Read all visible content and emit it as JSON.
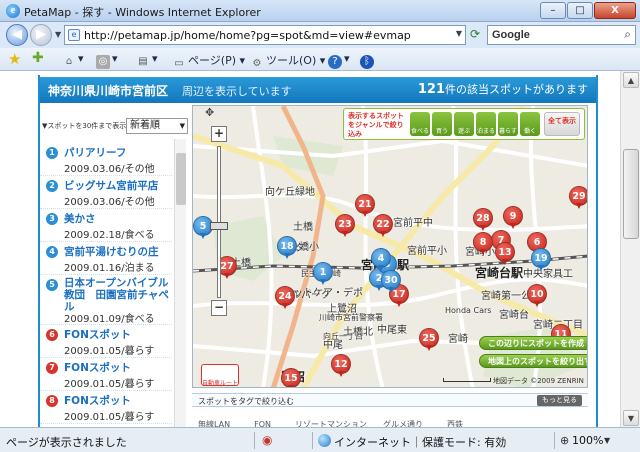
{
  "window": {
    "title": "PetaMap - 探す - Windows Internet Explorer",
    "logo_letter": "e",
    "minimize": "–",
    "maximize": "□",
    "close": "X"
  },
  "address": {
    "url": "http://petamap.jp/home/home?pg=spot&md=view#evmap",
    "search_placeholder": "Google"
  },
  "toolbar": {
    "page_menu": "ページ(P)",
    "tools_menu": "ツール(O)",
    "help_menu": "?"
  },
  "header": {
    "location": "神奈川県川崎市宮前区",
    "location_suffix": "周辺を表示しています",
    "count_number": "121",
    "count_text": "件の該当スポットがあります"
  },
  "sidebar": {
    "show_label": "▼スポットを30件まで表示",
    "sort_value": "新着順",
    "spots": [
      {
        "num": "1",
        "color": "blue",
        "name": "パリアリーフ",
        "meta": "2009.03.06/その他"
      },
      {
        "num": "2",
        "color": "blue",
        "name": "ビッグサム宮前平店",
        "meta": "2009.03.06/その他"
      },
      {
        "num": "3",
        "color": "blue",
        "name": "美かさ",
        "meta": "2009.02.18/食べる"
      },
      {
        "num": "4",
        "color": "blue",
        "name": "宮前平湯けむりの庄",
        "meta": "2009.01.16/泊まる"
      },
      {
        "num": "5",
        "color": "blue",
        "name": "日本オープンバイブル教団　田園宮前チャペル",
        "meta": "2009.01.09/食べる"
      },
      {
        "num": "6",
        "color": "red",
        "name": "FONスポット",
        "meta": "2009.01.05/暮らす"
      },
      {
        "num": "7",
        "color": "red",
        "name": "FONスポット",
        "meta": "2009.01.05/暮らす"
      },
      {
        "num": "8",
        "color": "red",
        "name": "FONスポット",
        "meta": "2009.01.05/暮らす"
      }
    ]
  },
  "map": {
    "genre_label": "表示するスポットをジャンルで絞り込み",
    "genres": [
      "食べる",
      "買う",
      "遊ぶ",
      "泊まる",
      "暮らす",
      "働く",
      "全て表示"
    ],
    "labels": [
      {
        "text": "向ケ丘緑地",
        "cls": ""
      },
      {
        "text": "宮前平駅",
        "cls": "big"
      },
      {
        "text": "宮崎台駅",
        "cls": "big"
      },
      {
        "text": "宮前平中",
        "cls": ""
      },
      {
        "text": "宮前平小",
        "cls": ""
      },
      {
        "text": "宮崎小",
        "cls": ""
      },
      {
        "text": "土橋",
        "cls": ""
      },
      {
        "text": "土橋小",
        "cls": ""
      },
      {
        "text": "宮崎第一公",
        "cls": ""
      },
      {
        "text": "中尾東",
        "cls": ""
      },
      {
        "text": "ルパーク",
        "cls": ""
      },
      {
        "text": "Honda Cars",
        "cls": "small"
      },
      {
        "text": "宮崎台",
        "cls": ""
      },
      {
        "text": "宮崎二丁目",
        "cls": ""
      },
      {
        "text": "中尾",
        "cls": ""
      },
      {
        "text": "トヨタ",
        "cls": ""
      },
      {
        "text": "鷺沼",
        "cls": "big"
      },
      {
        "text": "民主籍川崎",
        "cls": "small"
      },
      {
        "text": "ットケア・デポ",
        "cls": ""
      },
      {
        "text": "中央家具工",
        "cls": ""
      },
      {
        "text": "土橋",
        "cls": ""
      },
      {
        "text": "上鷺沼",
        "cls": ""
      },
      {
        "text": "川崎市宮前警察署",
        "cls": "small"
      },
      {
        "text": "向丘一丁目",
        "cls": "small"
      },
      {
        "text": "土橋北",
        "cls": ""
      },
      {
        "text": "宮崎",
        "cls": ""
      }
    ],
    "pins": [
      {
        "n": "1",
        "c": "blue"
      },
      {
        "n": "2",
        "c": "blue"
      },
      {
        "n": "3",
        "c": "blue"
      },
      {
        "n": "4",
        "c": "blue"
      },
      {
        "n": "5",
        "c": "blue"
      },
      {
        "n": "6",
        "c": "red"
      },
      {
        "n": "7",
        "c": "red"
      },
      {
        "n": "8",
        "c": "red"
      },
      {
        "n": "9",
        "c": "red"
      },
      {
        "n": "10",
        "c": "red"
      },
      {
        "n": "11",
        "c": "red"
      },
      {
        "n": "12",
        "c": "red"
      },
      {
        "n": "13",
        "c": "red"
      },
      {
        "n": "15",
        "c": "red"
      },
      {
        "n": "17",
        "c": "red"
      },
      {
        "n": "18",
        "c": "blue"
      },
      {
        "n": "19",
        "c": "blue"
      },
      {
        "n": "21",
        "c": "red"
      },
      {
        "n": "22",
        "c": "red"
      },
      {
        "n": "23",
        "c": "red"
      },
      {
        "n": "24",
        "c": "red"
      },
      {
        "n": "25",
        "c": "red"
      },
      {
        "n": "27",
        "c": "red"
      },
      {
        "n": "28",
        "c": "red"
      },
      {
        "n": "29",
        "c": "red"
      },
      {
        "n": "30",
        "c": "blue"
      }
    ],
    "create_button": "この辺りにスポットを作成",
    "narrow_button": "地図上のスポットを絞り出す",
    "copyright": "地図データ ©2009 ZENRIN",
    "car_route": "自動車ルート"
  },
  "tags": {
    "label": "スポットをタグで絞り込む",
    "more": "もっと見る",
    "visible_row": "無線LAN　　　FON　　　リゾートマンション　　グルメ通り　　　西鉄"
  },
  "status": {
    "message": "ページが表示されました",
    "zone": "インターネット｜保護モード: 有効",
    "zoom": "100%"
  },
  "colors": {
    "header_blue": "#1e8ccf",
    "pin_red": "#d9342b",
    "pin_blue": "#2b8fd3",
    "genre_green": "#6aab26"
  }
}
